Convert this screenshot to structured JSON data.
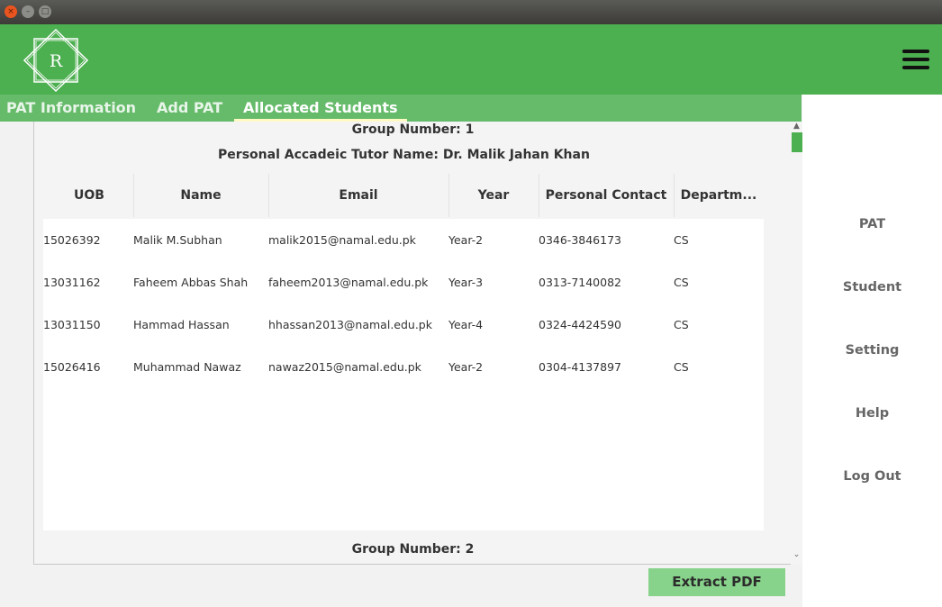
{
  "window": {
    "close_glyph": "×",
    "min_glyph": "–",
    "max_glyph": "□"
  },
  "header": {
    "logo_letter": "R"
  },
  "tabs": [
    {
      "label": "PAT Information"
    },
    {
      "label": "Add PAT"
    },
    {
      "label": "Allocated Students"
    }
  ],
  "group1": {
    "title": "Group Number:  1",
    "tutor": "Personal Accadeic Tutor Name: Dr. Malik Jahan Khan"
  },
  "columns": [
    "UOB",
    "Name",
    "Email",
    "Year",
    "Personal Contact",
    "Departm..."
  ],
  "rows": [
    [
      "15026392",
      "Malik M.Subhan",
      "malik2015@namal.edu.pk",
      "Year-2",
      "0346-3846173",
      "CS"
    ],
    [
      "13031162",
      "Faheem Abbas Shah",
      "faheem2013@namal.edu.pk",
      "Year-3",
      "0313-7140082",
      "CS"
    ],
    [
      "13031150",
      "Hammad Hassan",
      "hhassan2013@namal.edu.pk",
      "Year-4",
      "0324-4424590",
      "CS"
    ],
    [
      "15026416",
      "Muhammad Nawaz",
      "nawaz2015@namal.edu.pk",
      "Year-2",
      "0304-4137897",
      "CS"
    ]
  ],
  "group2": {
    "title": "Group Number:  2"
  },
  "scroll": {
    "up_glyph": "▲",
    "down_glyph": "⌄"
  },
  "extract_button": "Extract PDF",
  "sidebar": {
    "items": [
      "PAT",
      "Student",
      "Setting",
      "Help",
      "Log Out"
    ]
  },
  "colors": {
    "primary": "#4caf50",
    "tabbar": "#66bb6a",
    "button": "#88d38b"
  }
}
